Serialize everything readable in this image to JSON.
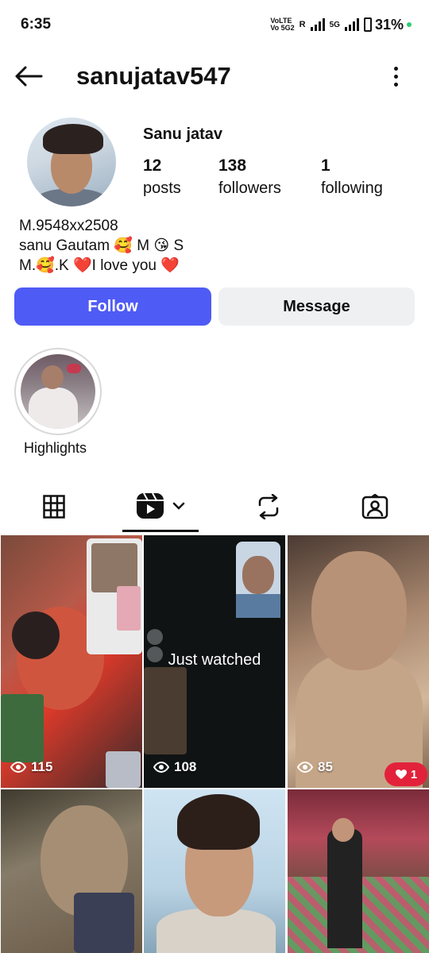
{
  "status": {
    "time": "6:35",
    "network_label": "VoLTE",
    "network_sub": "Vo 5G2",
    "roaming": "R",
    "gen": "5G",
    "battery": "31%"
  },
  "header": {
    "username": "sanujatav547"
  },
  "profile": {
    "display_name": "Sanu jatav",
    "posts_count": "12",
    "posts_label": "posts",
    "followers_count": "138",
    "followers_label": "followers",
    "following_count": "1",
    "following_label": "following",
    "bio_lines": [
      "M.9548xx2508",
      "sanu Gautam 🥰 M 😘 S",
      "M.🥰.K ❤️I love you ❤️"
    ]
  },
  "actions": {
    "follow": "Follow",
    "message": "Message"
  },
  "highlights": [
    {
      "label": "Highlights"
    }
  ],
  "tabs": [
    {
      "name": "grid-icon"
    },
    {
      "name": "reels-icon",
      "active": true
    },
    {
      "name": "reposts-icon"
    },
    {
      "name": "tagged-icon"
    }
  ],
  "grid": [
    {
      "views": "115"
    },
    {
      "views": "108",
      "overlay_text": "Just watched"
    },
    {
      "views": "85",
      "likes": "1"
    },
    {},
    {},
    {}
  ],
  "colors": {
    "follow_button": "#4f5bf5",
    "message_button": "#eff0f2",
    "like_badge": "#e2223a"
  }
}
